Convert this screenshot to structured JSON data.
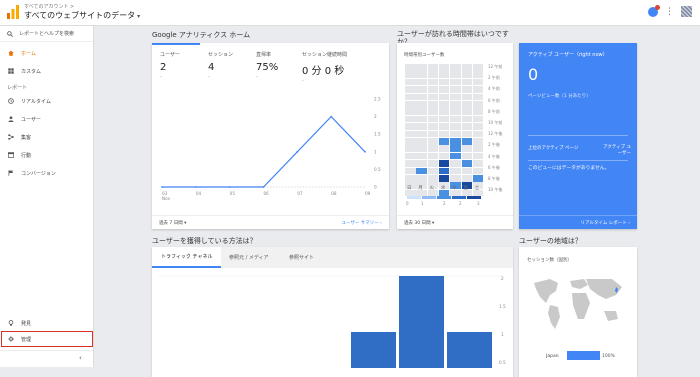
{
  "header": {
    "account_small": "すべてのアカウント >",
    "account_name": "すべてのウェブサイトのデータ",
    "caret": "▾",
    "kebab": "⋮",
    "colors": {
      "accent": "#4285f4",
      "logo": "#f4b400"
    }
  },
  "sidebar": {
    "search_label": "レポートとヘルプを検索",
    "items": [
      {
        "label": "ホーム",
        "icon": "home-icon",
        "active": true
      },
      {
        "label": "カスタム",
        "icon": "custom-grid-icon"
      }
    ],
    "section_label": "レポート",
    "reports": [
      {
        "label": "リアルタイム",
        "icon": "realtime-clock-icon"
      },
      {
        "label": "ユーザー",
        "icon": "person-icon"
      },
      {
        "label": "集客",
        "icon": "acquisition-icon"
      },
      {
        "label": "行動",
        "icon": "behavior-icon"
      },
      {
        "label": "コンバージョン",
        "icon": "flag-icon"
      }
    ],
    "discover_label": "発見",
    "admin_label": "管理",
    "collapse_glyph": "‹"
  },
  "home": {
    "title": "Google アナリティクス ホーム",
    "metrics": [
      {
        "label": "ユーザー",
        "value": "2",
        "sub": "-"
      },
      {
        "label": "セッション",
        "value": "4",
        "sub": "-"
      },
      {
        "label": "直帰率",
        "value": "75%",
        "sub": "-"
      },
      {
        "label": "セッション継続時間",
        "value": "0 分 0 秒",
        "sub": "-"
      }
    ],
    "footer_range": "過去 7 日間 ▾",
    "footer_link": "ユーザー サマリー",
    "footer_arrow": "›"
  },
  "time_card": {
    "title": "ユーザーが訪れる時間帯はいつですか？",
    "subtitle": "時間帯別ユーザー数",
    "hours": [
      "12 午前",
      "2 午前",
      "4 午前",
      "6 午前",
      "8 午前",
      "10 午前",
      "12 午後",
      "2 午後",
      "4 午後",
      "6 午後",
      "8 午後",
      "10 午後"
    ],
    "days": [
      "日",
      "月",
      "火",
      "水",
      "木",
      "金",
      "土"
    ],
    "legend_nums": [
      "0",
      "1",
      "2",
      "2",
      "3"
    ],
    "footer_range": "過去 30 日間 ▾"
  },
  "realtime": {
    "title": "アクティブ ユーザー（right now）",
    "value": "0",
    "pageviews_label": "ページビュー数（1 分あたり）",
    "col_left": "上位のアクティブ ページ",
    "col_right": "アクティブ ユーザー",
    "empty_text": "このビューにはデータがありません。",
    "footer_link": "リアルタイム レポート",
    "footer_arrow": "›"
  },
  "acquisition": {
    "title": "ユーザーを獲得している方法は？",
    "tabs": [
      "トラフィック チャネル",
      "参照元 / メディア",
      "参照サイト"
    ],
    "y_ticks": [
      "2",
      "1.5",
      "1",
      "0.5"
    ]
  },
  "geo": {
    "title": "ユーザーの地域は？",
    "subtitle": "セッション数（国別）",
    "country": "Japan",
    "percent": "100%",
    "percent_value": 100
  },
  "chart_data": {
    "type": "line",
    "x": [
      "03 Nov",
      "04",
      "05",
      "06",
      "07",
      "08",
      "09"
    ],
    "x_tick_labels": [
      "03",
      "04",
      "05",
      "06",
      "07",
      "08",
      "09"
    ],
    "x_sub_label": "Nov",
    "series": [
      {
        "values": [
          0,
          0,
          0,
          0,
          1,
          2,
          1
        ]
      }
    ],
    "ylim": [
      0,
      2.5
    ],
    "y_ticks": [
      "2.5",
      "2",
      "1.5",
      "1",
      "0.5",
      "0"
    ],
    "grid": false
  }
}
